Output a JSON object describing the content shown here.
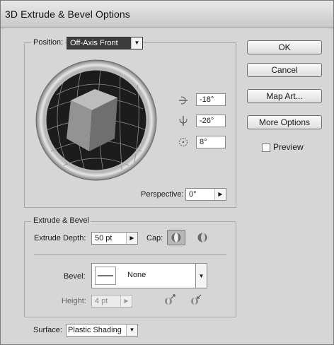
{
  "dialog": {
    "title": "3D Extrude & Bevel Options"
  },
  "position": {
    "label": "Position:",
    "value": "Off-Axis Front",
    "rotation_x": "-18°",
    "rotation_y": "-26°",
    "rotation_z": "8°",
    "perspective_label": "Perspective:",
    "perspective_value": "0°"
  },
  "buttons": {
    "ok": "OK",
    "cancel": "Cancel",
    "map_art": "Map Art...",
    "more_options": "More Options",
    "preview_label": "Preview"
  },
  "extrude": {
    "legend": "Extrude & Bevel",
    "depth_label": "Extrude Depth:",
    "depth_value": "50 pt",
    "cap_label": "Cap:",
    "bevel_label": "Bevel:",
    "bevel_value": "None",
    "height_label": "Height:",
    "height_value": "4 pt"
  },
  "surface": {
    "label": "Surface:",
    "value": "Plastic Shading"
  },
  "colors": {
    "cube_front": "#939393",
    "cube_top": "#bdbdbd",
    "cube_side": "#6f6f6f",
    "track_dark": "#1c1c1c"
  }
}
